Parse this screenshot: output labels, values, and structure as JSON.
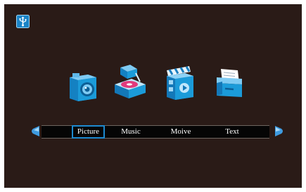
{
  "device": {
    "usb_badge_icon": "usb-drive-icon"
  },
  "media_icons": [
    {
      "icon": "camera-icon",
      "label": "Picture"
    },
    {
      "icon": "music-player-icon",
      "label": "Music"
    },
    {
      "icon": "clapperboard-icon",
      "label": "Movie"
    },
    {
      "icon": "document-tray-icon",
      "label": "Text"
    }
  ],
  "menu": {
    "items": [
      "Picture",
      "Music",
      "Moive",
      "Text"
    ],
    "selected_index": 0,
    "left_arrow_icon": "arrow-left-icon",
    "right_arrow_icon": "arrow-right-icon"
  },
  "colors": {
    "background": "#2a1b17",
    "accent": "#1d8ad0",
    "icon_blue": "#1b9bd9",
    "arrow_blue": "#3e9be0"
  }
}
